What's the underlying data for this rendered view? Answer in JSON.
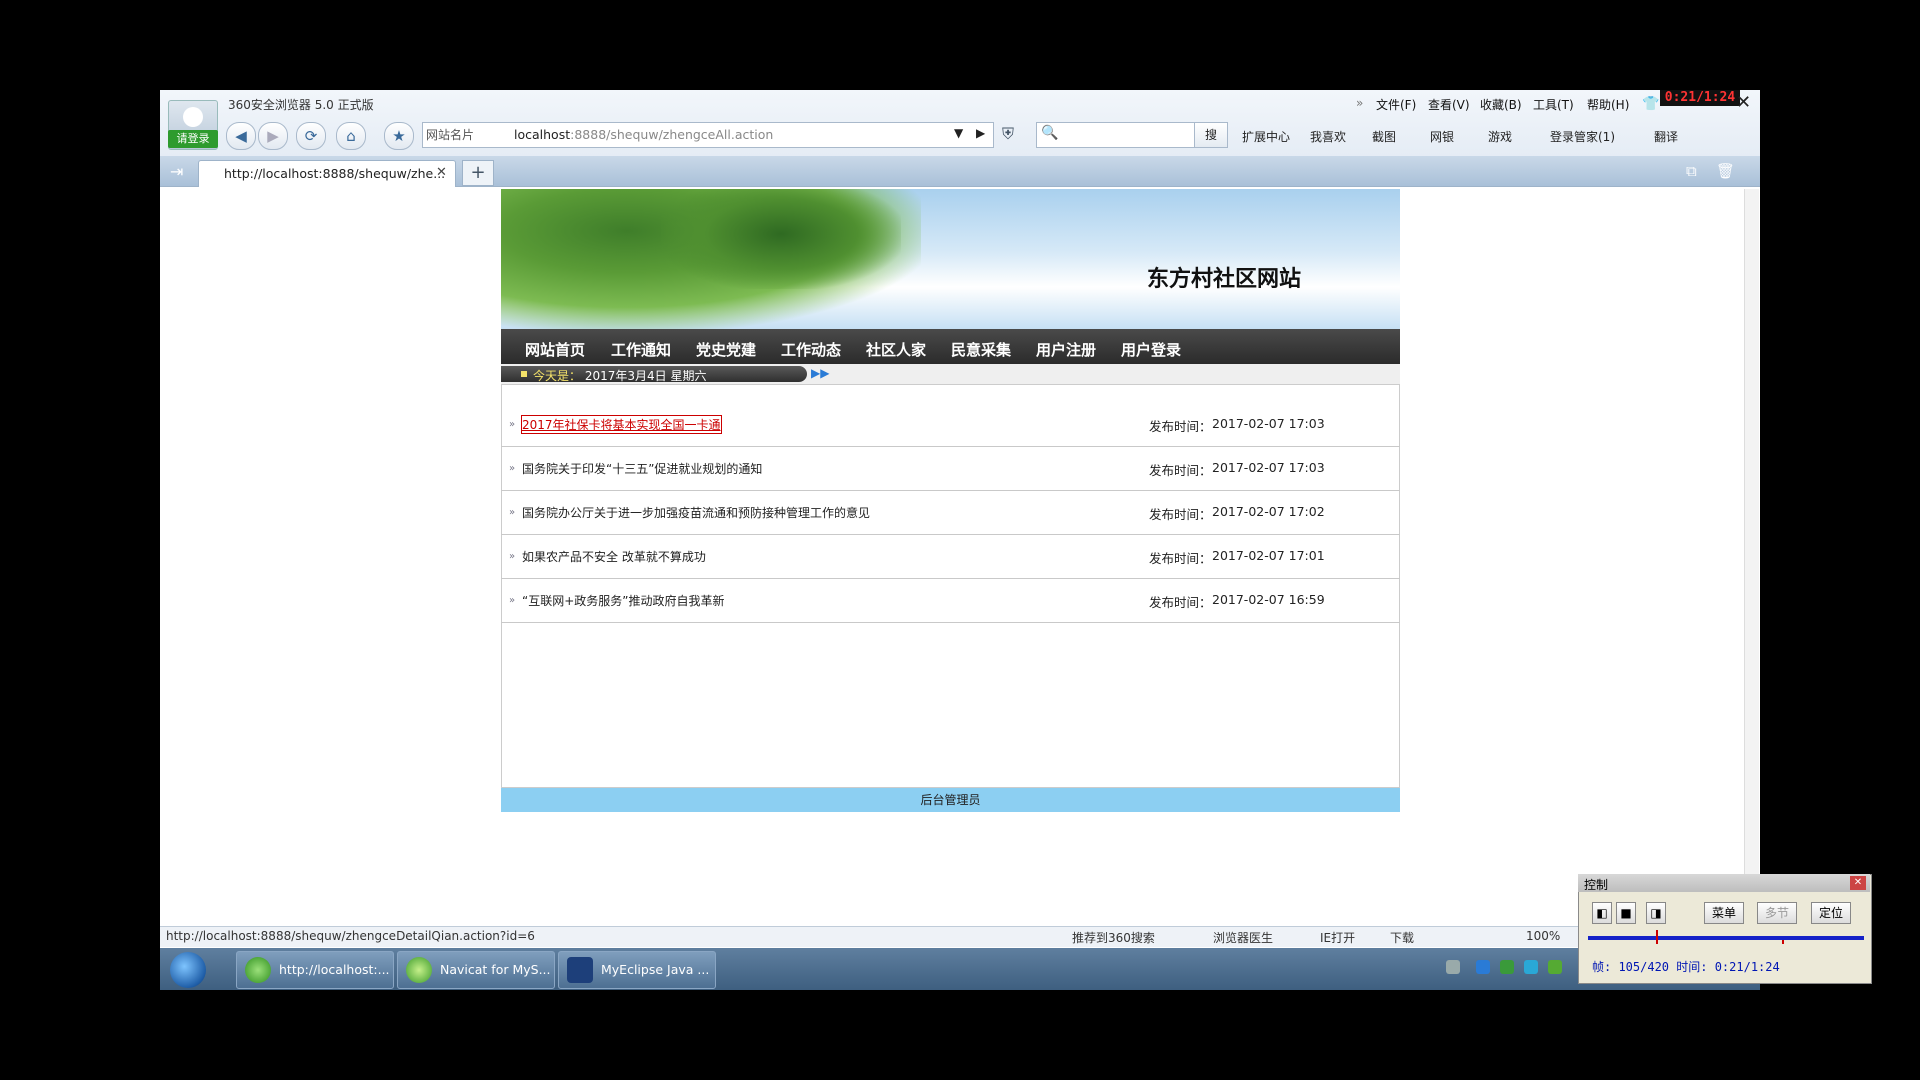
{
  "browser": {
    "title": "360安全浏览器 5.0 正式版",
    "login": "请登录",
    "menus": [
      "文件(F)",
      "查看(V)",
      "收藏(B)",
      "工具(T)",
      "帮助(H)"
    ],
    "clock": "0:21/1:24",
    "address_prefix": "网站名片",
    "url_host": "localhost",
    "url_rest": ":8888/shequw/zhengceAll.action",
    "search_button": "搜",
    "tools": [
      "扩展中心",
      "我喜欢",
      "截图",
      "网银",
      "游戏",
      "登录管家(1)",
      "翻译"
    ],
    "tab_label": "http://localhost:8888/shequw/zhe...",
    "status_url": "http://localhost:8888/shequw/zhengceDetailQian.action?id=6",
    "status_items": [
      "推荐到360搜索",
      "浏览器医生",
      "IE打开",
      "下载",
      "100%"
    ]
  },
  "site": {
    "title": "东方村社区网站",
    "nav": [
      "网站首页",
      "工作通知",
      "党史党建",
      "工作动态",
      "社区人家",
      "民意采集",
      "用户注册",
      "用户登录"
    ],
    "date_label": "今天是：",
    "date_value": "2017年3月4日 星期六",
    "publish_label": "发布时间：",
    "articles": [
      {
        "title": "2017年社保卡将基本实现全国一卡通",
        "time": "2017-02-07 17:03"
      },
      {
        "title": "国务院关于印发“十三五”促进就业规划的通知",
        "time": "2017-02-07 17:03"
      },
      {
        "title": "国务院办公厅关于进一步加强疫苗流通和预防接种管理工作的意见",
        "time": "2017-02-07 17:02"
      },
      {
        "title": "如果农产品不安全 改革就不算成功",
        "time": "2017-02-07 17:01"
      },
      {
        "title": "“互联网+政务服务”推动政府自我革新",
        "time": "2017-02-07 16:59"
      }
    ],
    "footer": "后台管理员"
  },
  "taskbar": {
    "tasks": [
      "http://localhost:...",
      "Navicat for MyS...",
      "MyEclipse Java ..."
    ]
  },
  "control": {
    "title": "控制",
    "buttons": [
      "菜单",
      "多节",
      "定位"
    ],
    "info": "帧: 105/420 时间: 0:21/1:24"
  }
}
